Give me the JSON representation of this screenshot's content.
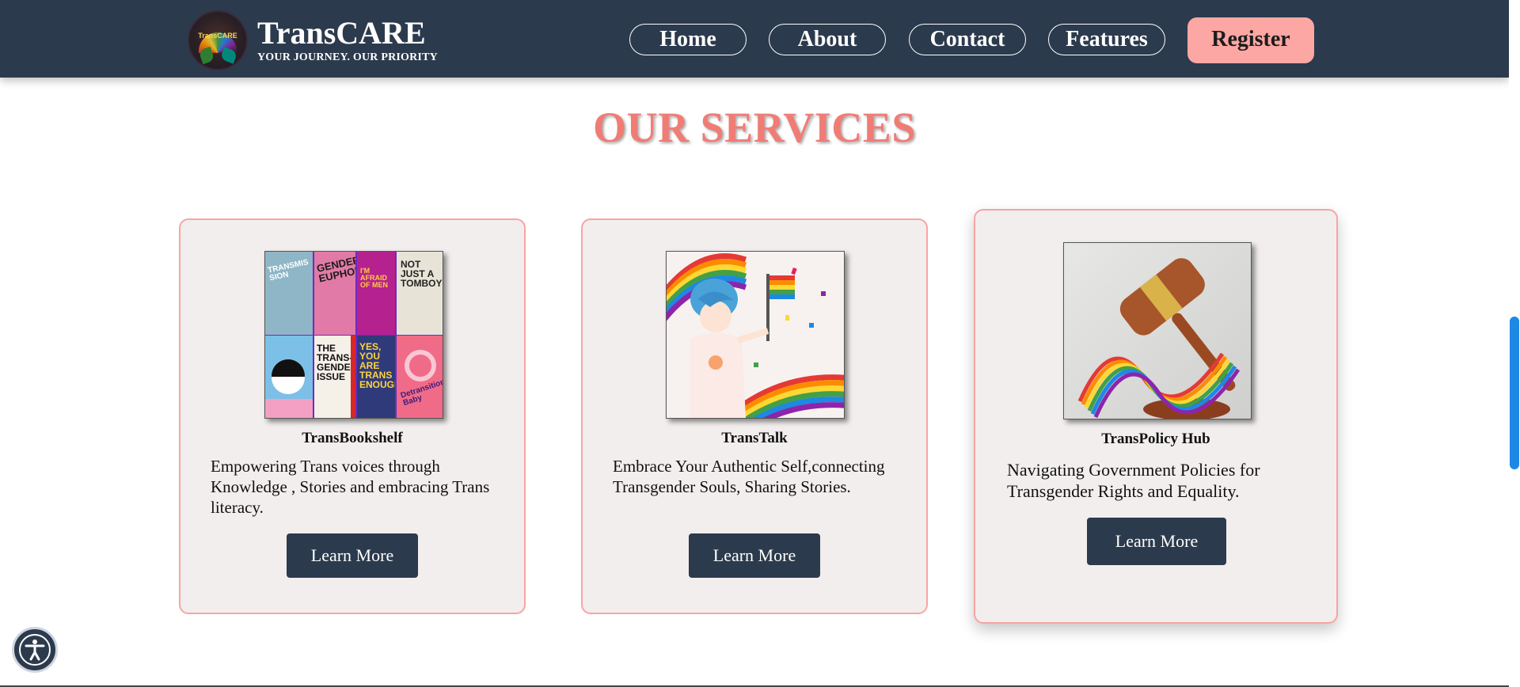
{
  "brand": {
    "name": "TransCARE",
    "tagline": "YOUR JOURNEY. OUR PRIORITY",
    "logo_text": "TransCARE",
    "logo_icon": "rainbow-tree-logo"
  },
  "nav": {
    "items": [
      {
        "label": "Home"
      },
      {
        "label": "About"
      },
      {
        "label": "Contact"
      },
      {
        "label": "Features"
      }
    ],
    "register_label": "Register"
  },
  "section": {
    "title": "OUR SERVICES"
  },
  "cards": [
    {
      "title": "TransBookshelf",
      "description": "Empowering Trans voices through Knowledge , Stories and embracing Trans literacy.",
      "button_label": "Learn More",
      "image": "book-covers-collage",
      "book_texts": [
        "TRANSMISSION",
        "GENDER EUPHORIA",
        "I'M AFRAID OF MEN",
        "NOT JUST A TOMBOY",
        "THE TRANS-GENDER ISSUE",
        "YES, YOU ARE TRANS ENOUGH",
        "Detransition Baby"
      ]
    },
    {
      "title": "TransTalk",
      "description": "Embrace Your Authentic Self,connecting Transgender Souls, Sharing Stories.",
      "button_label": "Learn More",
      "image": "person-with-pride-flag-illustration"
    },
    {
      "title": "TransPolicy Hub",
      "description": "Navigating Government Policies for Transgender Rights and Equality.",
      "button_label": "Learn More",
      "image": "gavel-with-rainbow-ribbon"
    }
  ],
  "accessibility": {
    "icon": "accessibility-person-icon"
  },
  "colors": {
    "header_bg": "#2c3a4d",
    "accent_pink": "#f07c76",
    "card_bg": "#f2eeee",
    "card_border": "#f7a5a3",
    "register_bg": "#fca7a3",
    "scroll_thumb": "#1e88e5"
  }
}
